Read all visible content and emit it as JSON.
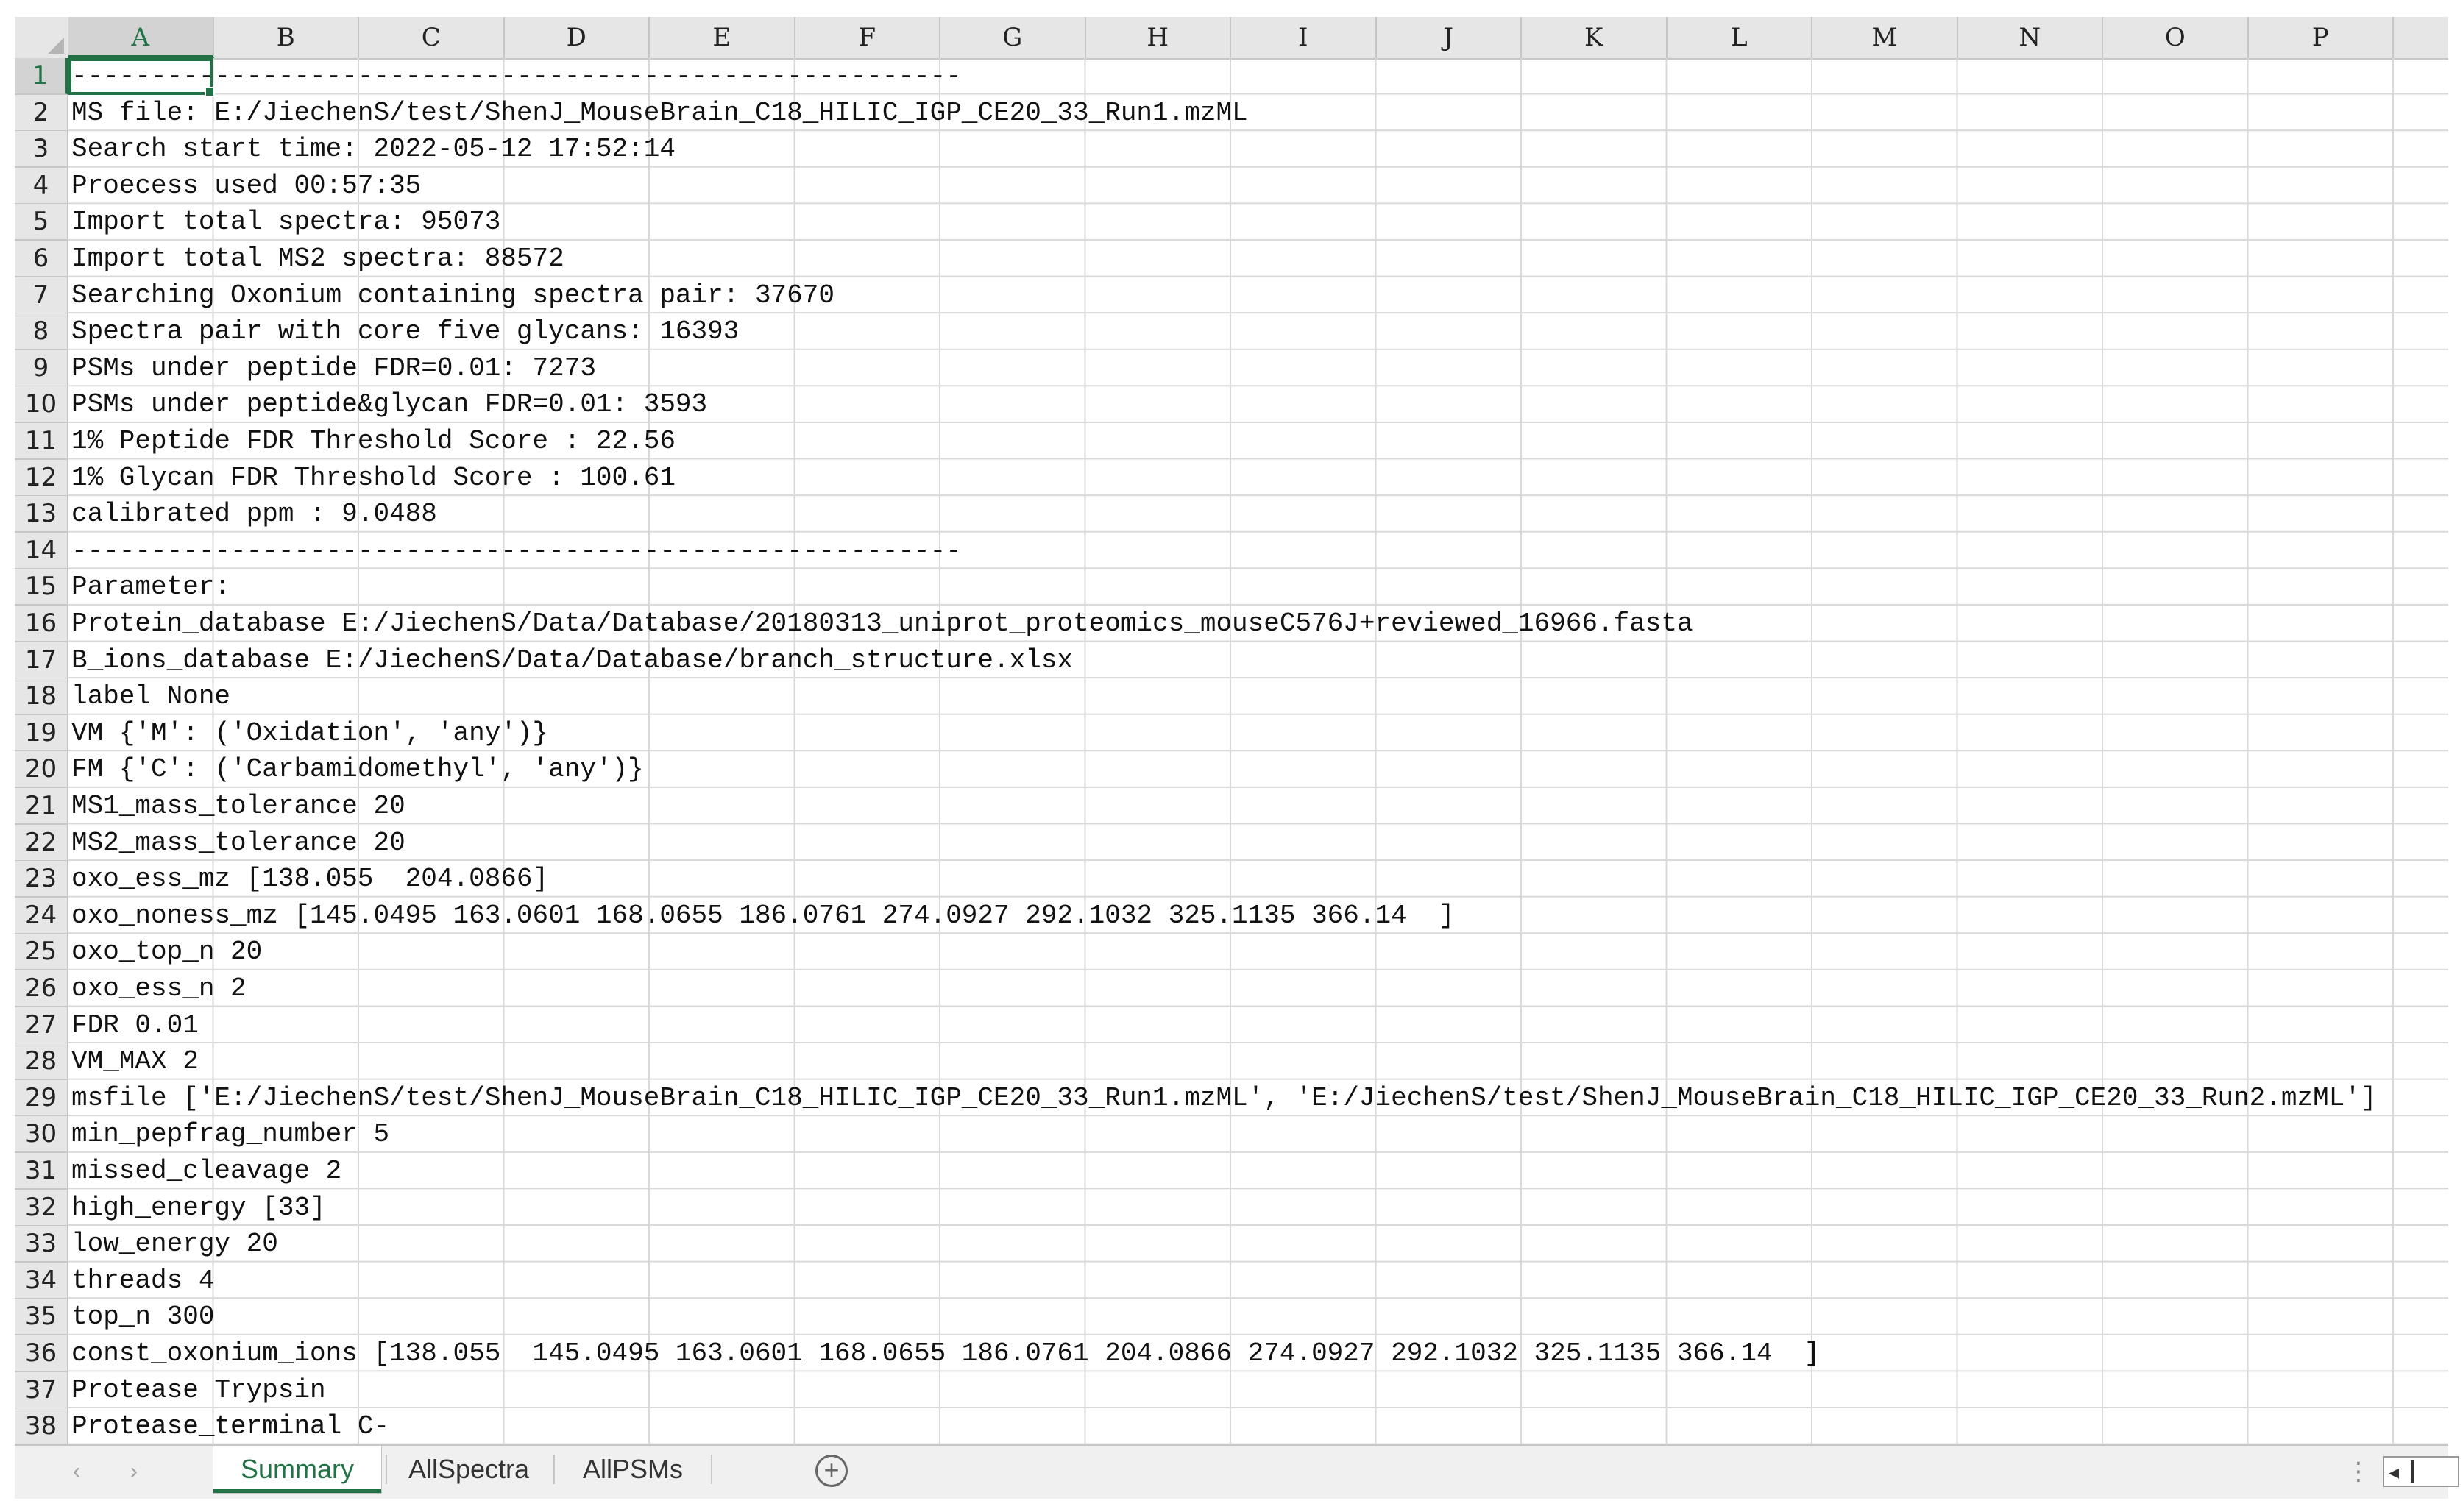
{
  "columns": [
    "A",
    "B",
    "C",
    "D",
    "E",
    "F",
    "G",
    "H",
    "I",
    "J",
    "K",
    "L",
    "M",
    "N",
    "O",
    "P"
  ],
  "selected_column": "A",
  "selected_row": "1",
  "rows": [
    {
      "num": "1",
      "text": "--------------------------------------------------------"
    },
    {
      "num": "2",
      "text": "MS file: E:/JiechenS/test/ShenJ_MouseBrain_C18_HILIC_IGP_CE20_33_Run1.mzML"
    },
    {
      "num": "3",
      "text": "Search start time: 2022-05-12 17:52:14"
    },
    {
      "num": "4",
      "text": "Proecess used 00:57:35"
    },
    {
      "num": "5",
      "text": "Import total spectra: 95073"
    },
    {
      "num": "6",
      "text": "Import total MS2 spectra: 88572"
    },
    {
      "num": "7",
      "text": "Searching Oxonium containing spectra pair: 37670"
    },
    {
      "num": "8",
      "text": "Spectra pair with core five glycans: 16393"
    },
    {
      "num": "9",
      "text": "PSMs under peptide FDR=0.01: 7273"
    },
    {
      "num": "10",
      "text": "PSMs under peptide&glycan FDR=0.01: 3593"
    },
    {
      "num": "11",
      "text": "1% Peptide FDR Threshold Score : 22.56"
    },
    {
      "num": "12",
      "text": "1% Glycan FDR Threshold Score : 100.61"
    },
    {
      "num": "13",
      "text": "calibrated ppm : 9.0488"
    },
    {
      "num": "14",
      "text": "--------------------------------------------------------"
    },
    {
      "num": "15",
      "text": "Parameter:"
    },
    {
      "num": "16",
      "text": "Protein_database E:/JiechenS/Data/Database/20180313_uniprot_proteomics_mouseC576J+reviewed_16966.fasta"
    },
    {
      "num": "17",
      "text": "B_ions_database E:/JiechenS/Data/Database/branch_structure.xlsx"
    },
    {
      "num": "18",
      "text": "label None"
    },
    {
      "num": "19",
      "text": "VM {'M': ('Oxidation', 'any')}"
    },
    {
      "num": "20",
      "text": "FM {'C': ('Carbamidomethyl', 'any')}"
    },
    {
      "num": "21",
      "text": "MS1_mass_tolerance 20"
    },
    {
      "num": "22",
      "text": "MS2_mass_tolerance 20"
    },
    {
      "num": "23",
      "text": "oxo_ess_mz [138.055  204.0866]"
    },
    {
      "num": "24",
      "text": "oxo_noness_mz [145.0495 163.0601 168.0655 186.0761 274.0927 292.1032 325.1135 366.14  ]"
    },
    {
      "num": "25",
      "text": "oxo_top_n 20"
    },
    {
      "num": "26",
      "text": "oxo_ess_n 2"
    },
    {
      "num": "27",
      "text": "FDR 0.01"
    },
    {
      "num": "28",
      "text": "VM_MAX 2"
    },
    {
      "num": "29",
      "text": "msfile ['E:/JiechenS/test/ShenJ_MouseBrain_C18_HILIC_IGP_CE20_33_Run1.mzML', 'E:/JiechenS/test/ShenJ_MouseBrain_C18_HILIC_IGP_CE20_33_Run2.mzML']"
    },
    {
      "num": "30",
      "text": "min_pepfrag_number 5"
    },
    {
      "num": "31",
      "text": "missed_cleavage 2"
    },
    {
      "num": "32",
      "text": "high_energy [33]"
    },
    {
      "num": "33",
      "text": "low_energy 20"
    },
    {
      "num": "34",
      "text": "threads 4"
    },
    {
      "num": "35",
      "text": "top_n 300"
    },
    {
      "num": "36",
      "text": "const_oxonium_ions [138.055  145.0495 163.0601 168.0655 186.0761 204.0866 274.0927 292.1032 325.1135 366.14  ]"
    },
    {
      "num": "37",
      "text": "Protease Trypsin"
    },
    {
      "num": "38",
      "text": "Protease_terminal C-"
    }
  ],
  "sheet_tabs": [
    {
      "label": "Summary",
      "active": true
    },
    {
      "label": "AllSpectra",
      "active": false
    },
    {
      "label": "AllPSMs",
      "active": false
    }
  ],
  "add_sheet_label": "+",
  "more_label": "⋮",
  "accent_color": "#217346"
}
